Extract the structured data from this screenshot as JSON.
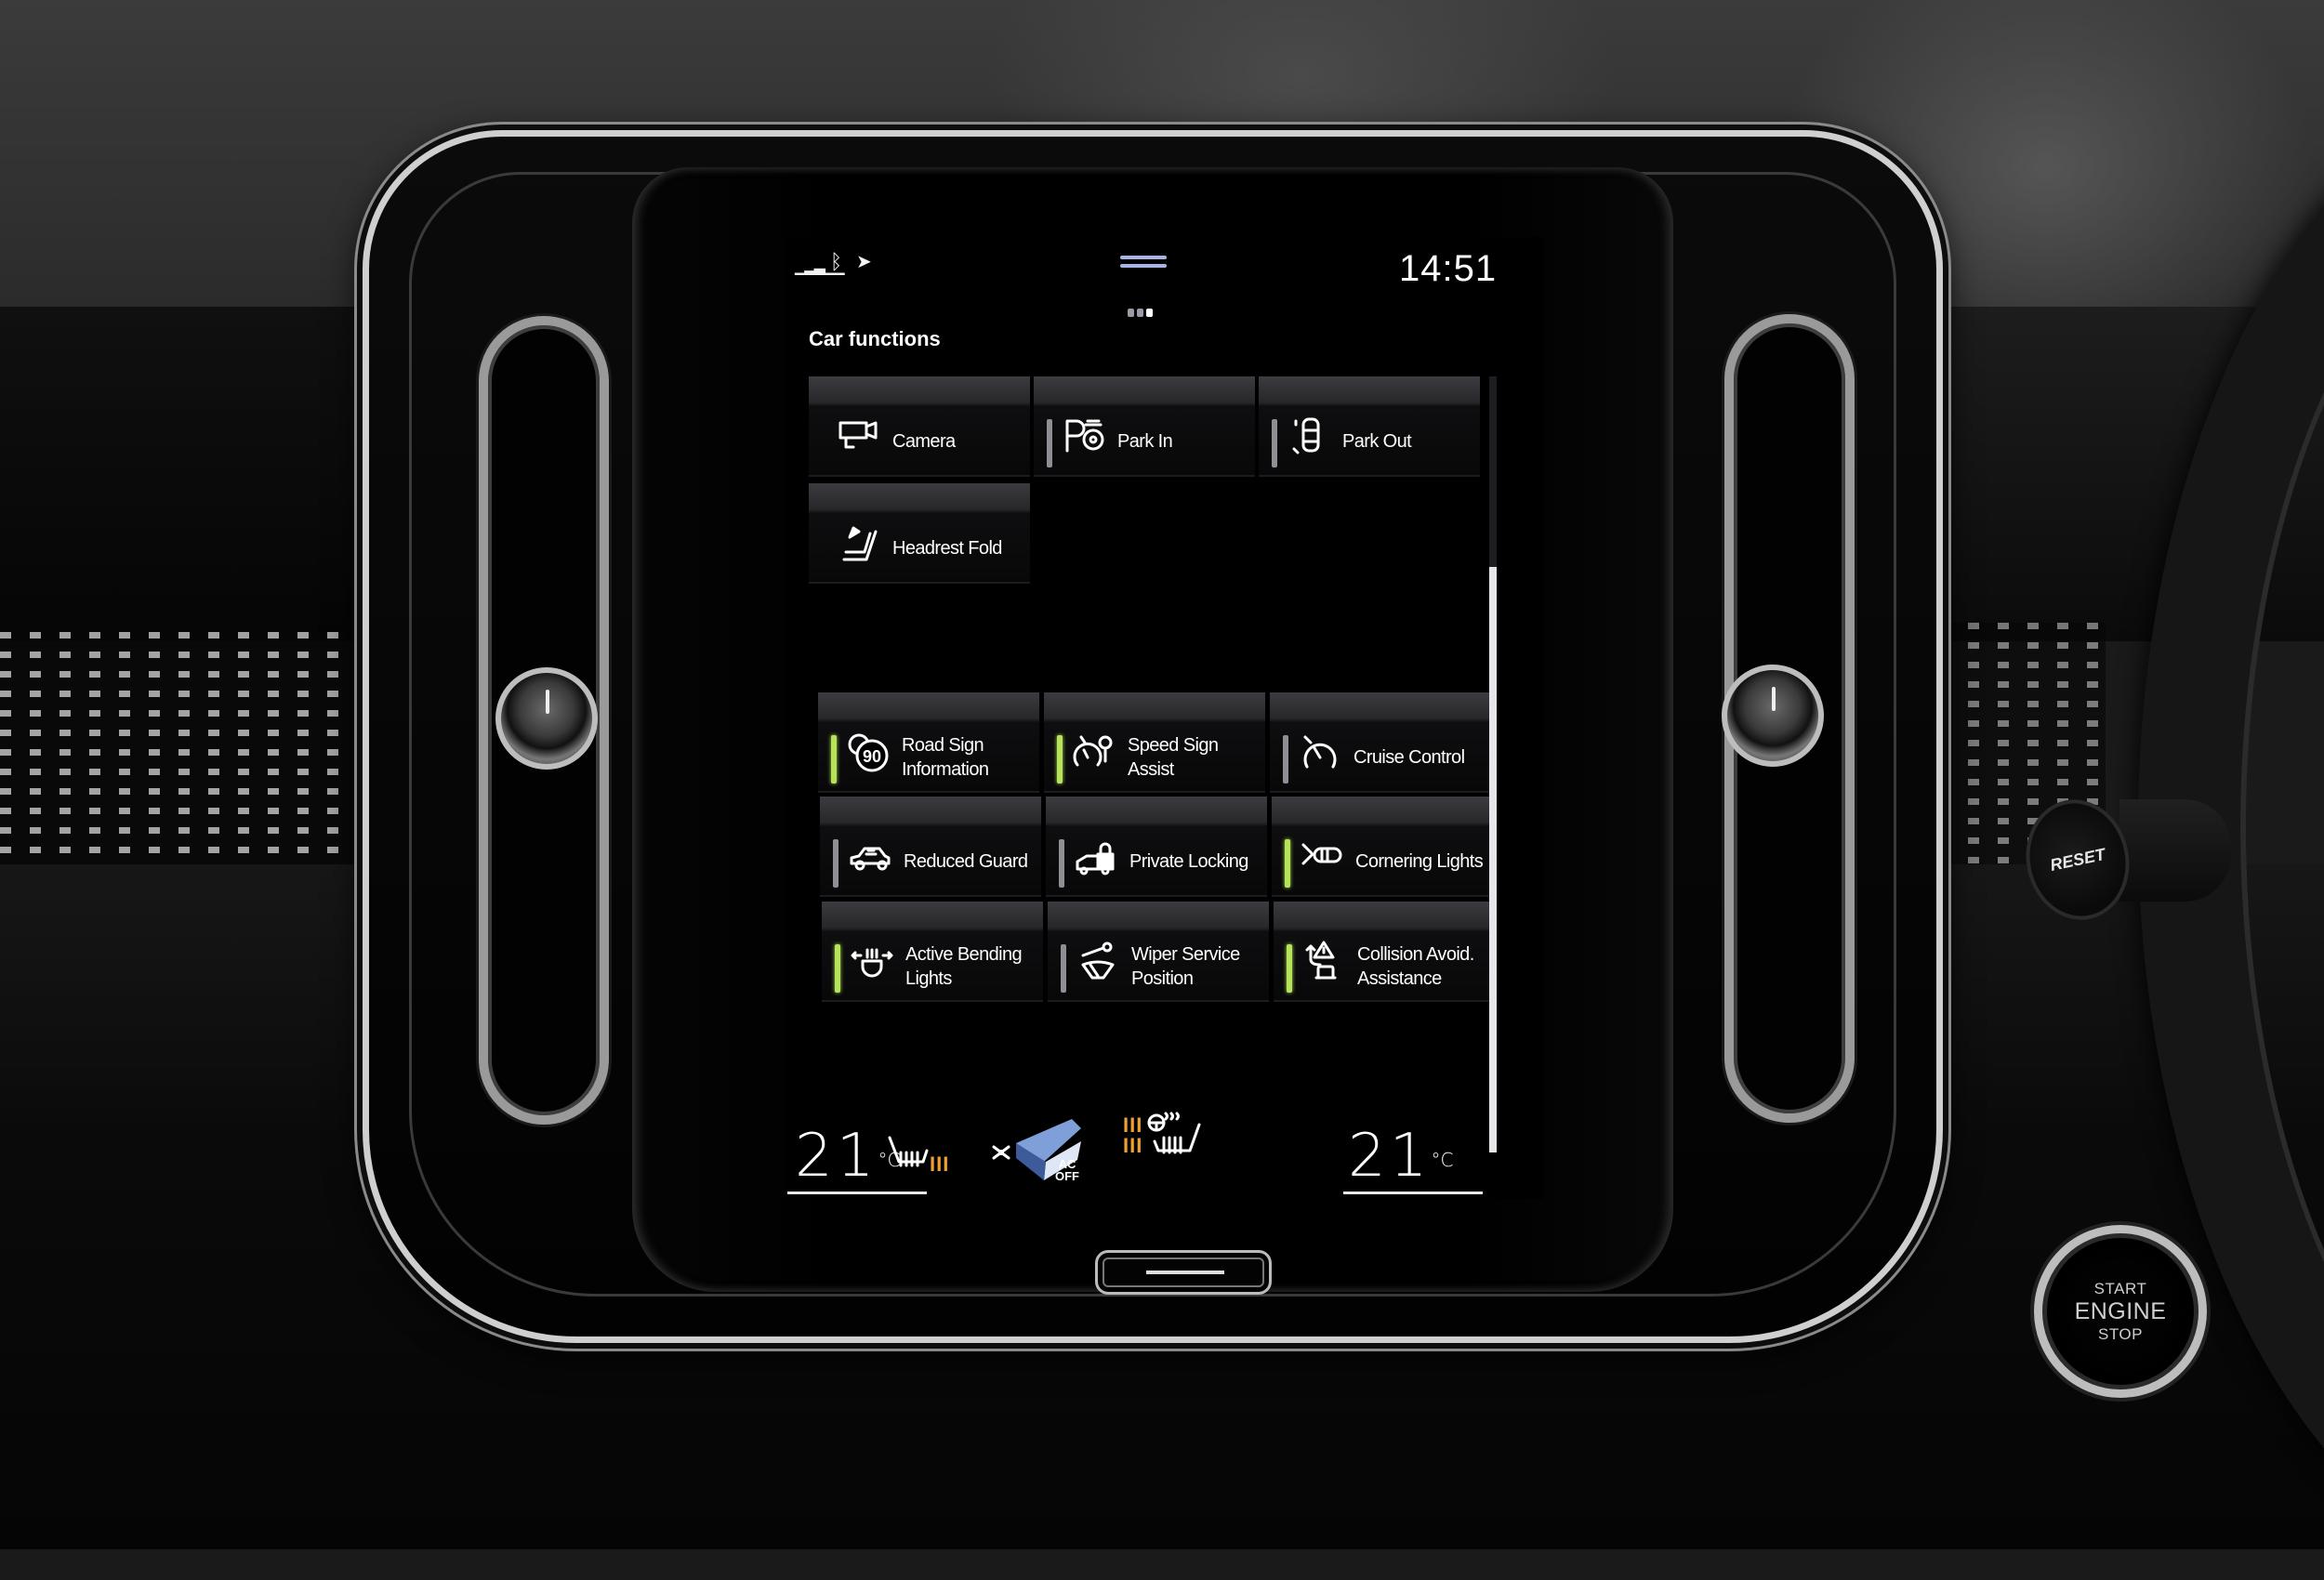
{
  "screen": {
    "status_bar": {
      "signal_icon": "signal-strength-icon",
      "bluetooth_icon": "bluetooth-icon",
      "navigation_icon": "location-arrow-icon",
      "clock": "14:51"
    },
    "page_indicator": {
      "pages": 3,
      "active_page": 3
    },
    "title": "Car functions",
    "tiles_top": [
      {
        "label": "Camera",
        "icon": "camera-icon",
        "indicator": "none"
      },
      {
        "label": "Park In",
        "icon": "park-in-icon",
        "indicator": "off"
      },
      {
        "label": "Park Out",
        "icon": "park-out-icon",
        "indicator": "off"
      },
      {
        "label": "Headrest Fold",
        "icon": "headrest-fold-icon",
        "indicator": "none"
      }
    ],
    "tiles_toggles": [
      {
        "label": "Road Sign Information",
        "icon": "road-sign-icon",
        "indicator": "on"
      },
      {
        "label": "Speed Sign Assist",
        "icon": "speed-sign-icon",
        "indicator": "on"
      },
      {
        "label": "Cruise Control",
        "icon": "cruise-control-icon",
        "indicator": "off"
      },
      {
        "label": "Reduced Guard",
        "icon": "reduced-guard-icon",
        "indicator": "off"
      },
      {
        "label": "Private Locking",
        "icon": "private-locking-icon",
        "indicator": "off"
      },
      {
        "label": "Cornering Lights",
        "icon": "cornering-lights-icon",
        "indicator": "on"
      },
      {
        "label": "Active Bending Lights",
        "icon": "active-bending-lights-icon",
        "indicator": "on"
      },
      {
        "label": "Wiper Service Position",
        "icon": "wiper-service-icon",
        "indicator": "off"
      },
      {
        "label": "Collision Avoid. Assistance",
        "icon": "collision-avoidance-icon",
        "indicator": "on"
      }
    ],
    "road_sign_value": "90",
    "climate": {
      "left_temp": "21",
      "right_temp": "21",
      "temp_unit": "°C",
      "left_seat_heat_level": 3,
      "right_seat_heat_level": 3,
      "steering_wheel_heat_level": 3,
      "heat_bars": "III",
      "ac_label_top": "AC",
      "ac_label_bottom": "OFF"
    },
    "colors": {
      "indicator_on": "#b6e35a",
      "indicator_off": "#8e8e94",
      "heat": "#f0a030",
      "fan_accent": "#7f9fd8",
      "handle": "#a9b3e6"
    }
  },
  "physical": {
    "reset_label": "RESET",
    "start_button": {
      "line1": "START",
      "line2": "ENGINE",
      "line3": "STOP"
    }
  }
}
